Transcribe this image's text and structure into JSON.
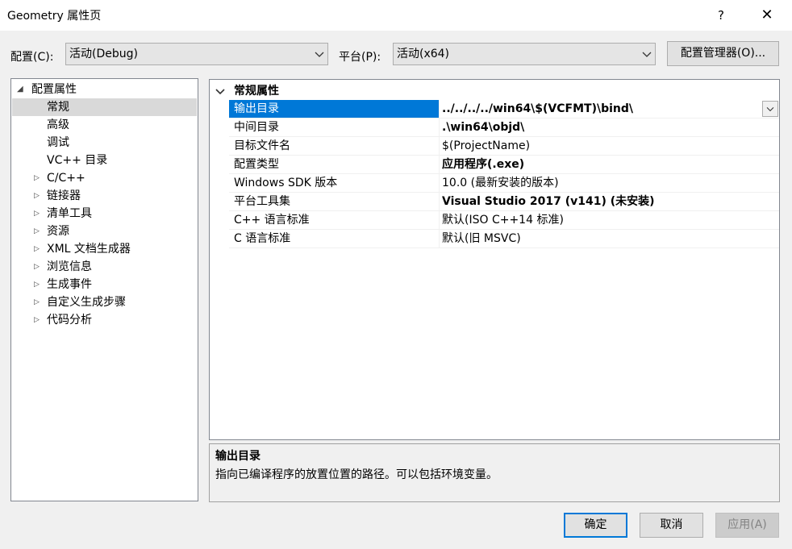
{
  "window": {
    "title": "Geometry 属性页",
    "help": "?",
    "close": "✕"
  },
  "config": {
    "label": "配置(C):",
    "value": "活动(Debug)"
  },
  "platform": {
    "label": "平台(P):",
    "value": "活动(x64)"
  },
  "config_manager_label": "配置管理器(O)...",
  "tree": {
    "root": "配置属性",
    "items": [
      {
        "label": "常规",
        "selected": true,
        "expandable": false
      },
      {
        "label": "高级",
        "expandable": false
      },
      {
        "label": "调试",
        "expandable": false
      },
      {
        "label": "VC++ 目录",
        "expandable": false
      },
      {
        "label": "C/C++",
        "expandable": true
      },
      {
        "label": "链接器",
        "expandable": true
      },
      {
        "label": "清单工具",
        "expandable": true
      },
      {
        "label": "资源",
        "expandable": true
      },
      {
        "label": "XML 文档生成器",
        "expandable": true
      },
      {
        "label": "浏览信息",
        "expandable": true
      },
      {
        "label": "生成事件",
        "expandable": true
      },
      {
        "label": "自定义生成步骤",
        "expandable": true
      },
      {
        "label": "代码分析",
        "expandable": true
      }
    ]
  },
  "grid": {
    "category": "常规属性",
    "rows": [
      {
        "name": "输出目录",
        "value": "../../../../win64\\$(VCFMT)\\bind\\",
        "bold": true,
        "selected": true
      },
      {
        "name": "中间目录",
        "value": ".\\win64\\objd\\",
        "bold": true
      },
      {
        "name": "目标文件名",
        "value": "$(ProjectName)",
        "bold": false
      },
      {
        "name": "配置类型",
        "value": "应用程序(.exe)",
        "bold": true
      },
      {
        "name": "Windows SDK 版本",
        "value": "10.0 (最新安装的版本)",
        "bold": false
      },
      {
        "name": "平台工具集",
        "value": "Visual Studio 2017 (v141) (未安装)",
        "bold": true
      },
      {
        "name": "C++ 语言标准",
        "value": "默认(ISO C++14 标准)",
        "bold": false
      },
      {
        "name": "C 语言标准",
        "value": "默认(旧 MSVC)",
        "bold": false
      }
    ]
  },
  "description": {
    "title": "输出目录",
    "text": "指向已编译程序的放置位置的路径。可以包括环境变量。"
  },
  "buttons": {
    "ok": "确定",
    "cancel": "取消",
    "apply": "应用(A)"
  },
  "colors": {
    "accent": "#0078d7"
  }
}
